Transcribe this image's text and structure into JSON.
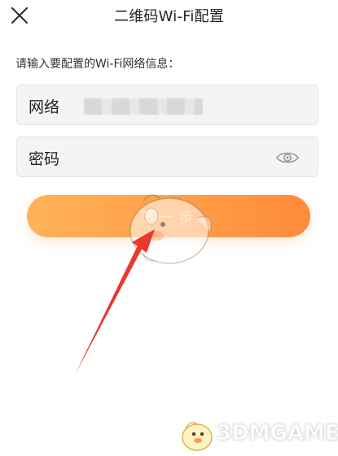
{
  "header": {
    "title": "二维码Wi-Fi配置",
    "close_icon": "close-icon"
  },
  "form": {
    "prompt": "请输入要配置的Wi-Fi网络信息：",
    "ssid_label": "网络",
    "password_label": "密码",
    "eye_icon": "eye-icon"
  },
  "actions": {
    "next_label": "下一步"
  },
  "watermark": {
    "text": "3DMGAME"
  },
  "colors": {
    "button_gradient_start": "#ffb25a",
    "button_gradient_end": "#ff8a3a",
    "field_background": "#f3f4f6",
    "arrow": "#e8392e"
  }
}
